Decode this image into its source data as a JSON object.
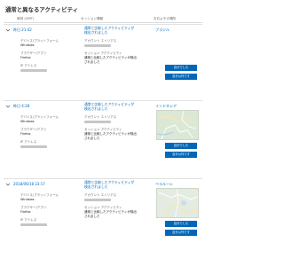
{
  "page": {
    "title": "通常と異なるアクティビティ"
  },
  "headers": {
    "time": "時刻 (GMT)",
    "session": "セッション情報",
    "activity": "",
    "location": "おおよその場所"
  },
  "labels": {
    "device": "デバイス/プラットフォーム",
    "browser": "ブラウザー/アプリ",
    "ip": "IP アドレス",
    "account": "アカウント エイリアス",
    "session_activity": "セッション アクティビティ"
  },
  "buttons": {
    "dismiss": "自分でした",
    "not_me": "自分以外です"
  },
  "activities": [
    {
      "time": "昨日 21:42",
      "device": "Windows",
      "browser": "Firefox",
      "link": "通常と比較したアクティビティが検出されました",
      "session_activity": "通常と比較したアクティビティが検出されました",
      "location": "ブラジル",
      "has_map": false
    },
    {
      "time": "昨日 4:28",
      "device": "Windows",
      "browser": "Firefox",
      "link": "通常と比較したアクティビティが検出されました",
      "session_activity": "通常と比較したアクティビティが検出されました",
      "location": "インドネシア",
      "has_map": true
    },
    {
      "time": "2018/06/18 23:17",
      "device": "Windows",
      "browser": "Firefox",
      "link": "通常と比較したアクティビティが検出されました",
      "session_activity": "通常と比較したアクティビティが検出されました",
      "location": "ベラルーシ",
      "has_map": true
    }
  ]
}
